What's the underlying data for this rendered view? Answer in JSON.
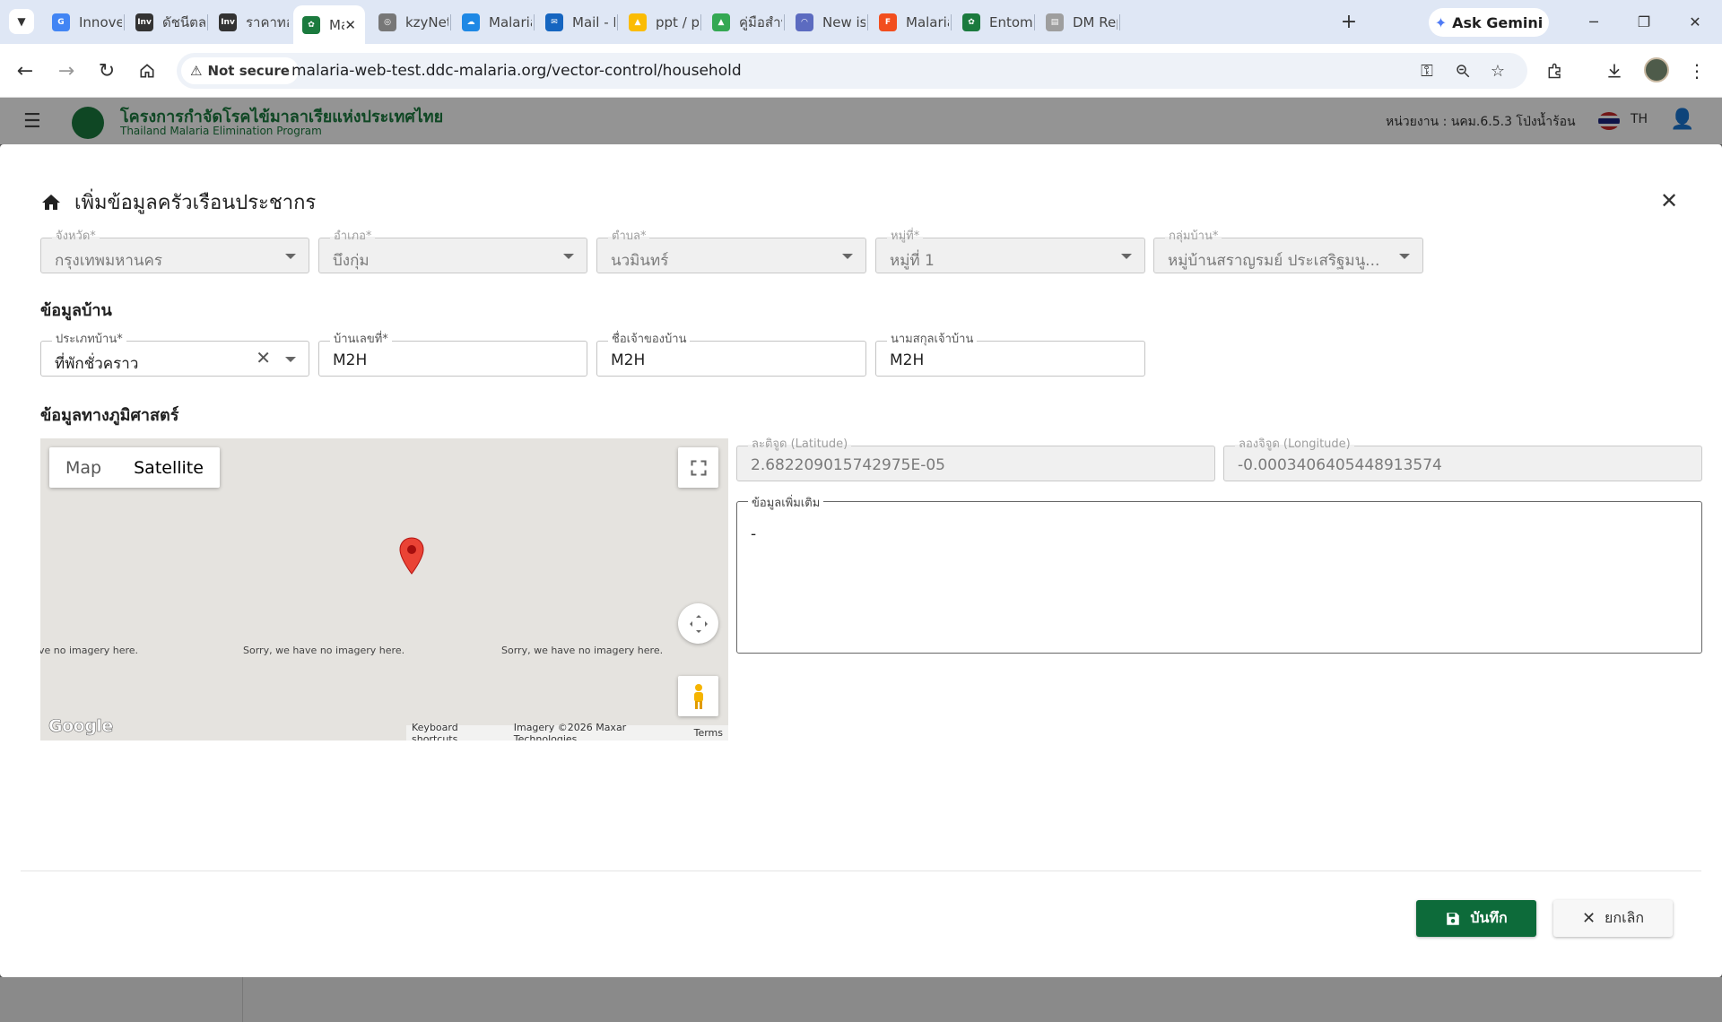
{
  "browser": {
    "tabs": [
      {
        "label": "Innoves",
        "color": "#4285f4",
        "glyph": "G"
      },
      {
        "label": "ดัชนีตลา",
        "color": "#333333",
        "glyph": "Inv"
      },
      {
        "label": "ราคาทอง",
        "color": "#333333",
        "glyph": "Inv"
      },
      {
        "label": "Ma",
        "color": "#1b7a3e",
        "glyph": "✿",
        "active": true
      },
      {
        "label": "kzyNet",
        "color": "#777777",
        "glyph": "◎"
      },
      {
        "label": "Malaria",
        "color": "#1e88e5",
        "glyph": "☁"
      },
      {
        "label": "Mail - P",
        "color": "#1565c0",
        "glyph": "✉"
      },
      {
        "label": "ppt / pc",
        "color": "#fbbc04",
        "glyph": "▲"
      },
      {
        "label": "คู่มือสำห",
        "color": "#34a853",
        "glyph": "▲"
      },
      {
        "label": "New iss",
        "color": "#5c6bc0",
        "glyph": "◠"
      },
      {
        "label": "Malaria",
        "color": "#f24e1e",
        "glyph": "F"
      },
      {
        "label": "Entomo",
        "color": "#1b7a3e",
        "glyph": "✿"
      },
      {
        "label": "DM Rep",
        "color": "#9e9e9e",
        "glyph": "▤"
      }
    ],
    "tab_close": "✕",
    "new_tab": "+",
    "gemini": "Ask Gemini",
    "not_secure": "Not secure",
    "url": "malaria-web-test.ddc-malaria.org/vector-control/household"
  },
  "app": {
    "title": "โครงการกำจัดโรคไข้มาลาเรียแห่งประเทศไทย",
    "subtitle": "Thailand Malaria Elimination Program",
    "unit": "หน่วยงาน : นคม.6.5.3 โป่งน้ำร้อน",
    "lang": "TH"
  },
  "dialog": {
    "title": "เพิ่มข้อมูลครัวเรือนประชากร",
    "location": {
      "province": {
        "label": "จังหวัด*",
        "value": "กรุงเทพมหานคร"
      },
      "district": {
        "label": "อำเภอ*",
        "value": "บึงกุ่ม"
      },
      "subdistrict": {
        "label": "ตำบล*",
        "value": "นวมินทร์"
      },
      "village_no": {
        "label": "หมู่ที่*",
        "value": "หมู่ที่ 1"
      },
      "village_group": {
        "label": "กลุ่มบ้าน*",
        "value": "หมู่บ้านสราญรมย์ ประเสริฐมนู..."
      }
    },
    "house_section": "ข้อมูลบ้าน",
    "house": {
      "type": {
        "label": "ประเภทบ้าน*",
        "value": "ที่พักชั่วคราว"
      },
      "number": {
        "label": "บ้านเลขที่*",
        "value": "M2H"
      },
      "owner_name": {
        "label": "ชื่อเจ้าของบ้าน",
        "value": "M2H"
      },
      "owner_surname": {
        "label": "นามสกุลเจ้าบ้าน",
        "value": "M2H"
      }
    },
    "geo_section": "ข้อมูลทางภูมิศาสตร์",
    "map": {
      "tab_map": "Map",
      "tab_satellite": "Satellite",
      "no_imagery_1": "ve no imagery here.",
      "no_imagery_2": "Sorry, we have no imagery here.",
      "no_imagery_3": "Sorry, we have no imagery here.",
      "logo": "Google",
      "shortcuts": "Keyboard shortcuts",
      "imagery": "Imagery ©2026 Maxar Technologies",
      "terms": "Terms"
    },
    "latitude": {
      "label": "ละติจูด (Latitude)",
      "value": "2.682209015742975E-05"
    },
    "longitude": {
      "label": "ลองจิจูด (Longitude)",
      "value": "-0.0003406405448913574"
    },
    "notes": {
      "label": "ข้อมูลเพิ่มเติม",
      "value": "-"
    },
    "save": "บันทึก",
    "cancel": "ยกเลิก"
  }
}
